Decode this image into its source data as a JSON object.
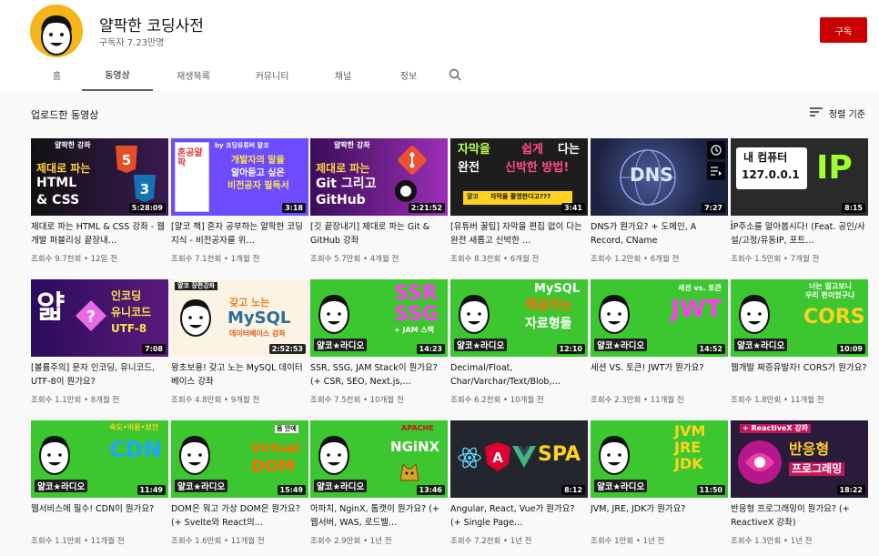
{
  "channel": {
    "name": "얄팍한 코딩사전",
    "subscribers": "구독자 7.23만명",
    "subscribe_label": "구독",
    "avatar_color": "#f3b51b"
  },
  "tabs": [
    {
      "label": "홈"
    },
    {
      "label": "동영상",
      "active": true
    },
    {
      "label": "재생목록"
    },
    {
      "label": "커뮤니티"
    },
    {
      "label": "채널"
    },
    {
      "label": "정보"
    }
  ],
  "section": {
    "title": "업로드한 동영상",
    "sort_label": "정렬 기준"
  },
  "videos": [
    {
      "title": "제대로 파는 HTML & CSS 강좌 - 웹개발 퍼블리싱 끝장내…",
      "meta": "조회수 9.7천회 • 12일 전",
      "duration": "5:28:09",
      "thumb_lines": [
        "얄팍한 강좌",
        "제대로 파는",
        "HTML",
        "& CSS"
      ]
    },
    {
      "title": "[얄코 책] 혼자 공부하는 얄팍한 코딩지식 - 비전공자를 위…",
      "meta": "조회수 7.1천회 • 1개월 전",
      "duration": "3:18",
      "thumb_lines": [
        "혼공얄팍",
        "by 코딩유튜버 얄코",
        "개발자의 말을",
        "알아듣고 싶은",
        "비전공자 필독서"
      ]
    },
    {
      "title": "[깃 끝장내기] 제대로 파는 Git & GitHub 강좌",
      "meta": "조회수 5.7만회 • 4개월 전",
      "duration": "2:21:52",
      "thumb_lines": [
        "얄팍한 강좌",
        "제대로 파는",
        "Git 그리고",
        "GitHub"
      ]
    },
    {
      "title": "[유튜버 꿀팁] 자막을 편집 없이 다는 완전 새롭고 신박한 …",
      "meta": "조회수 8.3천회 • 6개월 전",
      "duration": "3:41",
      "thumb_lines": [
        "자막을",
        "쉽게",
        "다는",
        "완전",
        "신박한 방법!",
        "얄코",
        "자막을 촬영한다고???"
      ]
    },
    {
      "title": "DNS가 뭔가요? + 도메인, A Record, CName",
      "meta": "조회수 1.2만회 • 6개월 전",
      "duration": "7:27",
      "thumb_lines": [
        "DNS"
      ]
    },
    {
      "title": "IP주소를 알아봅시다! (Feat. 공인/사설/고정/유동IP, 포트…",
      "meta": "조회수 1.5만회 • 7개월 전",
      "duration": "8:15",
      "thumb_lines": [
        "내 컴퓨터",
        "127.0.0.1",
        "IP"
      ]
    },
    {
      "title": "[볼륨주의] 문자 인코딩, 유니코드, UTF-8이 뭔가요?",
      "meta": "조회수 1.1만회 • 8개월 전",
      "duration": "7:08",
      "thumb_lines": [
        "얇",
        "인코딩",
        "유니코드",
        "UTF-8"
      ]
    },
    {
      "title": "왕초보용! 갖고 노는 MySQL 데이터베이스 강좌",
      "meta": "조회수 4.8만회 • 9개월 전",
      "duration": "2:52:53",
      "thumb_lines": [
        "얄코 장편강좌",
        "갖고 노는",
        "MySQL",
        "데이터베이스 강좌"
      ]
    },
    {
      "title": "SSR, SSG, JAM Stack이 뭔가요? (+ CSR, SEO, Next.js,…",
      "meta": "조회수 7.5천회 • 10개월 전",
      "duration": "14:23",
      "thumb_lines": [
        "SSR",
        "SSG",
        "+ JAM 스택",
        "얄코★라디오"
      ]
    },
    {
      "title": "Decimal/Float, Char/Varchar/Text/Blob,…",
      "meta": "조회수 6.2천회 • 10개월 전",
      "duration": "12:10",
      "thumb_lines": [
        "MySQL",
        "헷갈리는",
        "자료형들",
        "얄코★라디오"
      ]
    },
    {
      "title": "세션 VS. 토큰! JWT가 뭔가요?",
      "meta": "조회수 2.3만회 • 11개월 전",
      "duration": "14:52",
      "thumb_lines": [
        "세션 vs. 토큰",
        "JWT",
        "얄코★라디오"
      ]
    },
    {
      "title": "웹개발 짜증유발자! CORS가 뭔가요?",
      "meta": "조회수 1.8만회 • 11개월 전",
      "duration": "10:09",
      "thumb_lines": [
        "너는 알고보니",
        "우리 편이었구나",
        "CORS",
        "얄코★라디오"
      ]
    },
    {
      "title": "웹서비스에 필수! CDN이 뭔가요?",
      "meta": "조회수 1.1만회 • 11개월 전",
      "duration": "11:49",
      "thumb_lines": [
        "속도•비용•보안",
        "CDN",
        "얄코★라디오"
      ]
    },
    {
      "title": "DOM은 뭐고 가상 DOM은 뭔가요? (+ Svelte와 React의…",
      "meta": "조회수 1.6만회 • 11개월 전",
      "duration": "15:49",
      "thumb_lines": [
        "몸 안에",
        "Virtual",
        "DOM",
        "얄코★라디오"
      ]
    },
    {
      "title": "아파치, NginX, 톰캣이 뭔가요? (+ 웹서버, WAS, 로드밸…",
      "meta": "조회수 2.9만회 • 1년 전",
      "duration": "13:46",
      "thumb_lines": [
        "APACHE",
        "NGiNX",
        "얄코★라디오"
      ]
    },
    {
      "title": "Angular, React, Vue가 뭔가요? (+ Single Page…",
      "meta": "조회수 7.2천회 • 1년 전",
      "duration": "8:12",
      "thumb_lines": [
        "A",
        "V",
        "SPA"
      ]
    },
    {
      "title": "JVM, JRE, JDK가 뭔가요?",
      "meta": "조회수 1만회 • 1년 전",
      "duration": "11:50",
      "thumb_lines": [
        "JVM",
        "JRE",
        "JDK",
        "얄코★라디오"
      ]
    },
    {
      "title": "반응형 프로그래밍이 뭔가요? (+ ReactiveX 강좌)",
      "meta": "조회수 1.3만회 • 1년 전",
      "duration": "18:22",
      "thumb_lines": [
        "+ ReactiveX 강좌",
        "반응형",
        "프로그래밍"
      ]
    }
  ],
  "colors": {
    "subscribe": "#cc0000",
    "radio_green": "#3cc62f"
  }
}
